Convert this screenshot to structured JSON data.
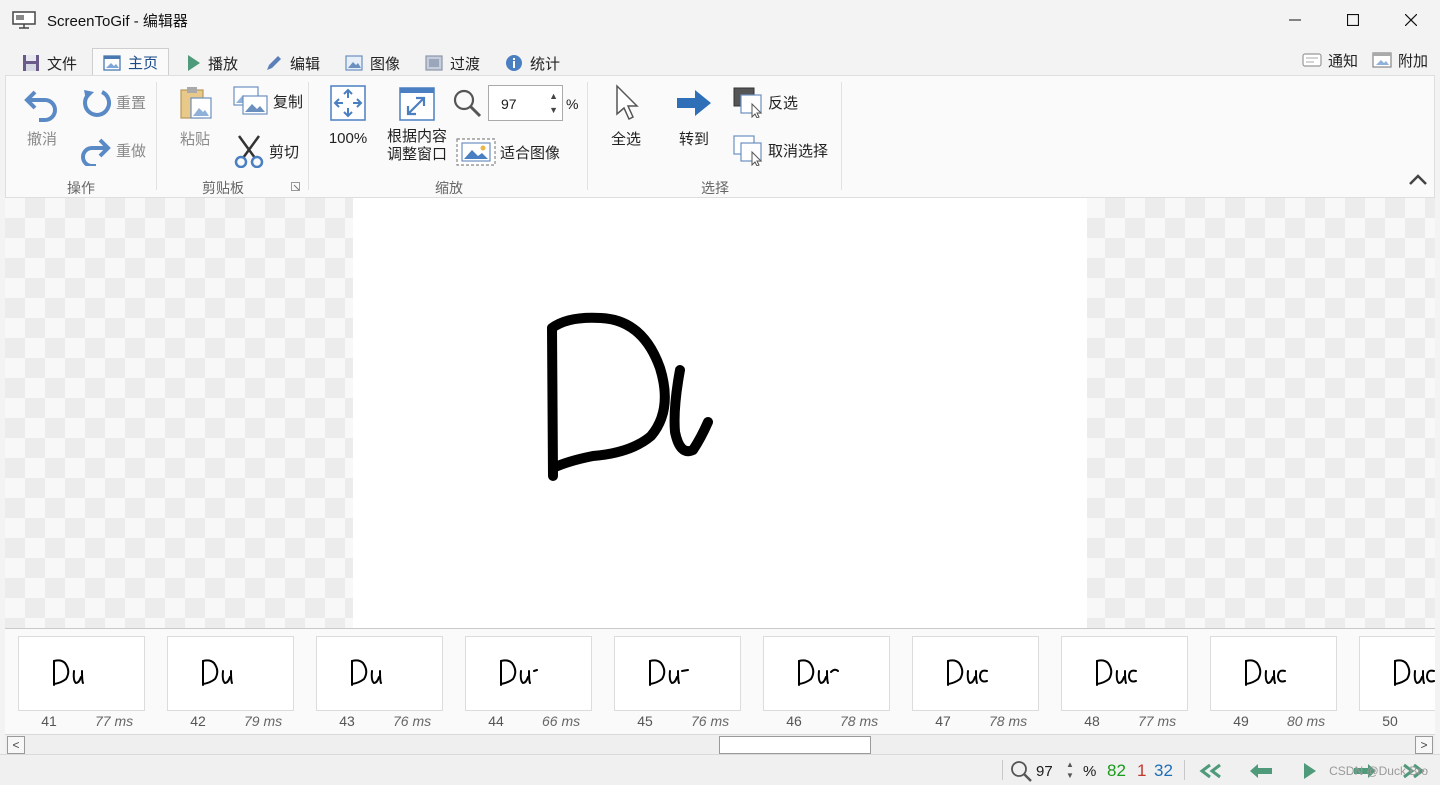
{
  "window": {
    "title": "ScreenToGif - 编辑器",
    "app_icon": "monitor-icon",
    "buttons": [
      "minimize-icon",
      "maximize-icon",
      "close-icon"
    ]
  },
  "tabs": [
    {
      "label": "文件",
      "icon": "save-icon"
    },
    {
      "label": "主页",
      "icon": "home-image-icon",
      "active": true
    },
    {
      "label": "播放",
      "icon": "play-icon"
    },
    {
      "label": "编辑",
      "icon": "pencil-icon"
    },
    {
      "label": "图像",
      "icon": "image-icon"
    },
    {
      "label": "过渡",
      "icon": "transition-icon"
    },
    {
      "label": "统计",
      "icon": "info-icon"
    }
  ],
  "tabs_right": [
    {
      "label": "通知",
      "icon": "notification-icon"
    },
    {
      "label": "附加",
      "icon": "extras-icon"
    }
  ],
  "ribbon": {
    "groups": {
      "actions": {
        "label": "操作",
        "undo": "撤消",
        "reset": "重置",
        "redo": "重做"
      },
      "clipboard": {
        "label": "剪贴板",
        "paste": "粘贴",
        "copy": "复制",
        "cut": "剪切"
      },
      "zoom": {
        "label": "缩放",
        "zoom_100": "100%",
        "fit_window_line1": "根据内容",
        "fit_window_line2": "调整窗口",
        "zoom_value": "97",
        "zoom_unit": "%",
        "fit_image": "适合图像"
      },
      "select": {
        "label": "选择",
        "select_all": "全选",
        "go_to": "转到",
        "inverse": "反选",
        "deselect": "取消选择"
      }
    }
  },
  "frames": [
    {
      "number": "41",
      "delay": "77 ms",
      "drawing": "Du"
    },
    {
      "number": "42",
      "delay": "79 ms",
      "drawing": "Du"
    },
    {
      "number": "43",
      "delay": "76 ms",
      "drawing": "Du"
    },
    {
      "number": "44",
      "delay": "66 ms",
      "drawing": "Du-"
    },
    {
      "number": "45",
      "delay": "76 ms",
      "drawing": "Du-"
    },
    {
      "number": "46",
      "delay": "78 ms",
      "drawing": "Du-"
    },
    {
      "number": "47",
      "delay": "78 ms",
      "drawing": "Duc"
    },
    {
      "number": "48",
      "delay": "77 ms",
      "drawing": "Duc"
    },
    {
      "number": "49",
      "delay": "80 ms",
      "drawing": "Duc"
    },
    {
      "number": "50",
      "delay": "",
      "drawing": "Duc"
    }
  ],
  "status": {
    "zoom_value": "97",
    "zoom_unit": "%",
    "frame_count": "82",
    "selected_count": "1",
    "current_frame": "32",
    "colors": {
      "frame_count": "#1a9a1a",
      "selected_count": "#c0392b",
      "current_frame": "#1f6fb5"
    },
    "nav_icons": [
      "first-frame-icon",
      "previous-frame-icon",
      "play-icon",
      "next-frame-icon"
    ],
    "watermark": "CSDN @Duck Bro"
  }
}
